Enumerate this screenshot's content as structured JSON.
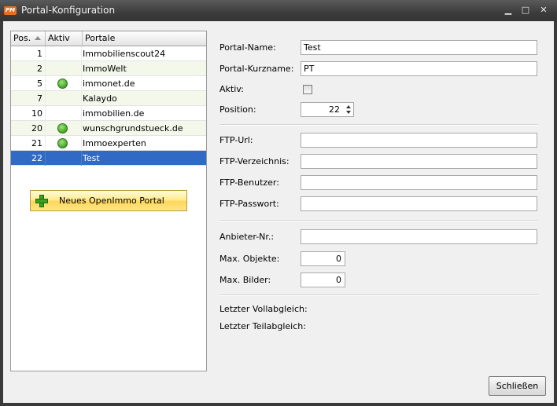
{
  "window": {
    "title": "Portal-Konfiguration",
    "logo_text": "PM",
    "minimize_glyph": "▁",
    "maximize_glyph": "□",
    "close_glyph": "✕"
  },
  "grid": {
    "columns": [
      "Pos.",
      "Aktiv",
      "Portale"
    ],
    "sorted_column": "Pos.",
    "rows": [
      {
        "pos": "1",
        "aktiv": false,
        "name": "Immobilienscout24"
      },
      {
        "pos": "2",
        "aktiv": false,
        "name": "ImmoWelt"
      },
      {
        "pos": "5",
        "aktiv": true,
        "name": "immonet.de"
      },
      {
        "pos": "7",
        "aktiv": false,
        "name": "Kalaydo"
      },
      {
        "pos": "10",
        "aktiv": false,
        "name": "immobilien.de"
      },
      {
        "pos": "20",
        "aktiv": true,
        "name": "wunschgrundstueck.de"
      },
      {
        "pos": "21",
        "aktiv": true,
        "name": "Immoexperten"
      },
      {
        "pos": "22",
        "aktiv": false,
        "name": "Test",
        "selected": true
      }
    ]
  },
  "new_portal_button": "Neues OpenImmo Portal",
  "form": {
    "portal_name_label": "Portal-Name:",
    "portal_name_value": "Test",
    "portal_short_label": "Portal-Kurzname:",
    "portal_short_value": "PT",
    "active_label": "Aktiv:",
    "active_checked": false,
    "position_label": "Position:",
    "position_value": "22",
    "ftp_url_label": "FTP-Url:",
    "ftp_url_value": "",
    "ftp_dir_label": "FTP-Verzeichnis:",
    "ftp_dir_value": "",
    "ftp_user_label": "FTP-Benutzer:",
    "ftp_user_value": "",
    "ftp_pass_label": "FTP-Passwort:",
    "ftp_pass_value": "",
    "provider_no_label": "Anbieter-Nr.:",
    "provider_no_value": "",
    "max_objects_label": "Max. Objekte:",
    "max_objects_value": "0",
    "max_images_label": "Max. Bilder:",
    "max_images_value": "0",
    "last_full_sync_label": "Letzter Vollabgleich:",
    "last_partial_sync_label": "Letzter Teilabgleich:"
  },
  "close_button": "Schließen",
  "colors": {
    "selection": "#316ac5",
    "active_indicator": "#43a823",
    "button_gold": "#ffd75a"
  }
}
